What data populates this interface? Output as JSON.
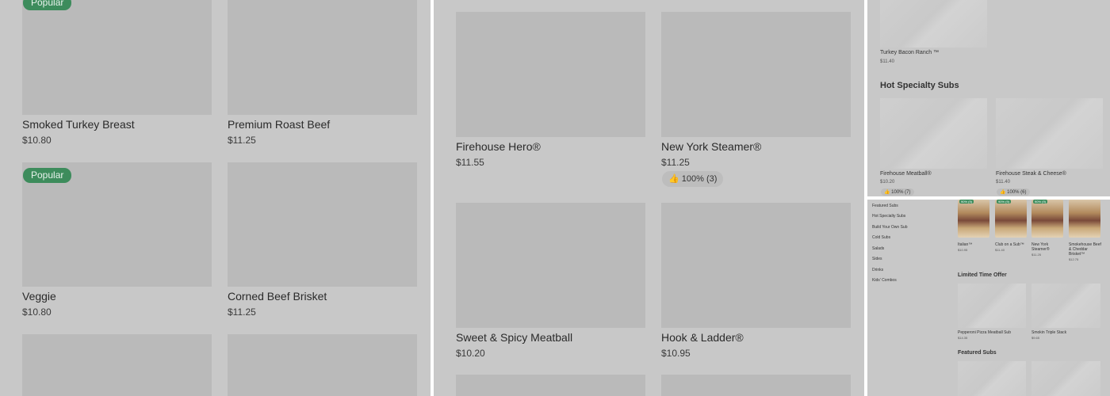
{
  "panel1": {
    "items": [
      {
        "name": "Smoked Turkey Breast",
        "price": "$10.80",
        "badge": "Popular"
      },
      {
        "name": "Premium Roast Beef",
        "price": "$11.25"
      },
      {
        "name": "Veggie",
        "price": "$10.80",
        "badge": "Popular"
      },
      {
        "name": "Corned Beef Brisket",
        "price": "$11.25"
      }
    ]
  },
  "panel2": {
    "items": [
      {
        "name": "Firehouse Hero®",
        "price": "$11.55"
      },
      {
        "name": "New York Steamer®",
        "price": "$11.25",
        "rating": "100% (3)"
      },
      {
        "name": "Sweet & Spicy Meatball",
        "price": "$10.20"
      },
      {
        "name": "Hook & Ladder®",
        "price": "$10.95"
      }
    ]
  },
  "panel3": {
    "top_item": {
      "name": "Turkey Bacon Ranch ™",
      "price": "$11.40"
    },
    "section_title": "Hot Specialty Subs",
    "items": [
      {
        "name": "Firehouse Meatball®",
        "price": "$10.20",
        "rating": "100% (7)"
      },
      {
        "name": "Firehouse Steak & Cheese®",
        "price": "$11.40",
        "rating": "100% (6)"
      }
    ]
  },
  "panel4": {
    "nav": [
      "Featured Subs",
      "Hot Specialty Subs",
      "Build Your Own Sub",
      "Cold Subs",
      "Salads",
      "Sides",
      "Drinks",
      "Kids' Combos"
    ],
    "top_items": [
      {
        "name": "Italian™",
        "price": "$10.95",
        "badge": "90% (9)"
      },
      {
        "name": "Club on a Sub™",
        "price": "$11.40",
        "badge": "90% (9)"
      },
      {
        "name": "New York Steamer®",
        "price": "$11.25",
        "badge": "90% (9)"
      },
      {
        "name": "Smokehouse Beef & Cheddar Brisket™",
        "price": "$12.75"
      }
    ],
    "limited_title": "Limited Time Offer",
    "limited_items": [
      {
        "name": "Pepperoni Pizza Meatball Sub",
        "price": "$14.35"
      },
      {
        "name": "Smokin Triple Stack",
        "price": "$9.65"
      }
    ],
    "featured_title": "Featured Subs"
  }
}
